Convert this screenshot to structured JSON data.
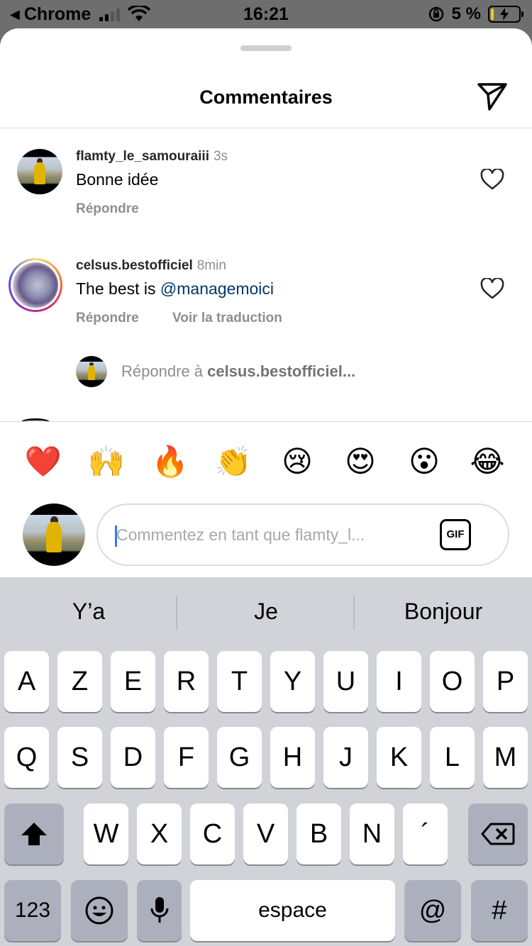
{
  "status_bar": {
    "back_label": "Chrome",
    "time": "16:21",
    "battery": "5 %"
  },
  "header": {
    "title": "Commentaires"
  },
  "comments": [
    {
      "username": "flamty_le_samouraiii",
      "time": "3s",
      "text": "Bonne idée",
      "reply": "Répondre"
    },
    {
      "username": "celsus.bestofficiel",
      "time": "8min",
      "text_prefix": "The best is ",
      "mention": "@managemoici",
      "reply": "Répondre",
      "translate": "Voir la traduction"
    }
  ],
  "reply_prompt": {
    "prefix": "Répondre à ",
    "target": "celsus.bestofficiel..."
  },
  "emojis": [
    "❤️",
    "🙌",
    "🔥",
    "👏",
    "😢",
    "😍",
    "😮",
    "😂"
  ],
  "composer": {
    "placeholder": "Commentez en tant que flamty_l...",
    "gif_label": "GIF"
  },
  "keyboard": {
    "suggestions": [
      "Y’a",
      "Je",
      "Bonjour"
    ],
    "row1": [
      "A",
      "Z",
      "E",
      "R",
      "T",
      "Y",
      "U",
      "I",
      "O",
      "P"
    ],
    "row2": [
      "Q",
      "S",
      "D",
      "F",
      "G",
      "H",
      "J",
      "K",
      "L",
      "M"
    ],
    "row3": [
      "W",
      "X",
      "C",
      "V",
      "B",
      "N",
      "´"
    ],
    "numbers_label": "123",
    "space_label": "espace",
    "at_label": "@",
    "hash_label": "#"
  }
}
